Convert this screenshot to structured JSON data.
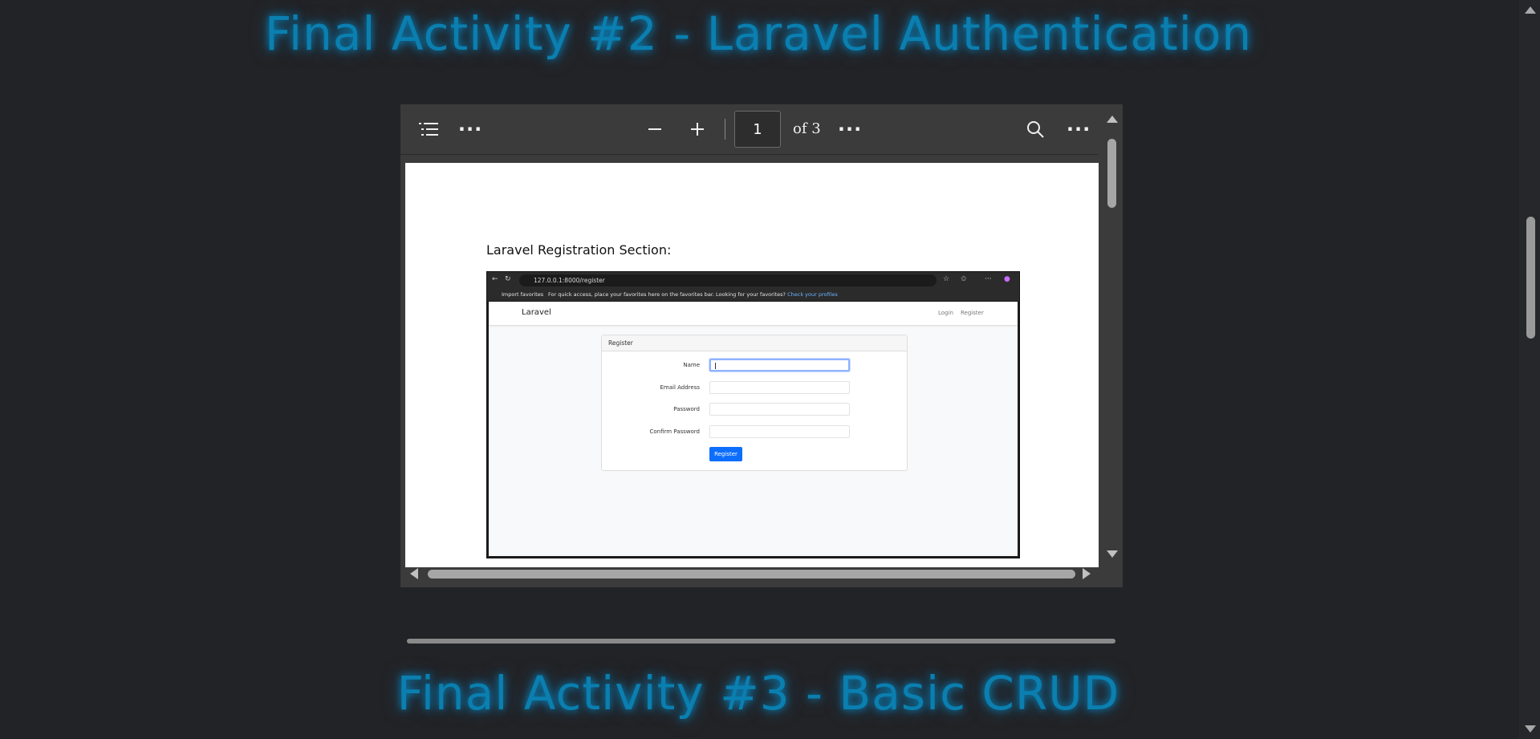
{
  "sections": {
    "activity2_title": "Final Activity #2 - Laravel Authentication",
    "activity3_title": "Final Activity #3 - Basic CRUD"
  },
  "viewer": {
    "current_page": "1",
    "total_label": "of 3"
  },
  "document": {
    "heading": "Laravel Registration Section:"
  },
  "embedded_browser": {
    "url": "127.0.0.1:8000/register",
    "favorites_import": "Import favorites",
    "favorites_message": "For quick access, place your favorites here on the favorites bar. Looking for your favorites?",
    "favorites_link": "Check your profiles"
  },
  "embedded_app": {
    "brand": "Laravel",
    "nav_login": "Login",
    "nav_register": "Register",
    "card_title": "Register",
    "fields": [
      {
        "label": "Name"
      },
      {
        "label": "Email Address"
      },
      {
        "label": "Password"
      },
      {
        "label": "Confirm Password"
      }
    ],
    "submit_label": "Register"
  },
  "colors": {
    "title_glow": "#0a7fb0",
    "button_primary": "#0d6efd"
  }
}
